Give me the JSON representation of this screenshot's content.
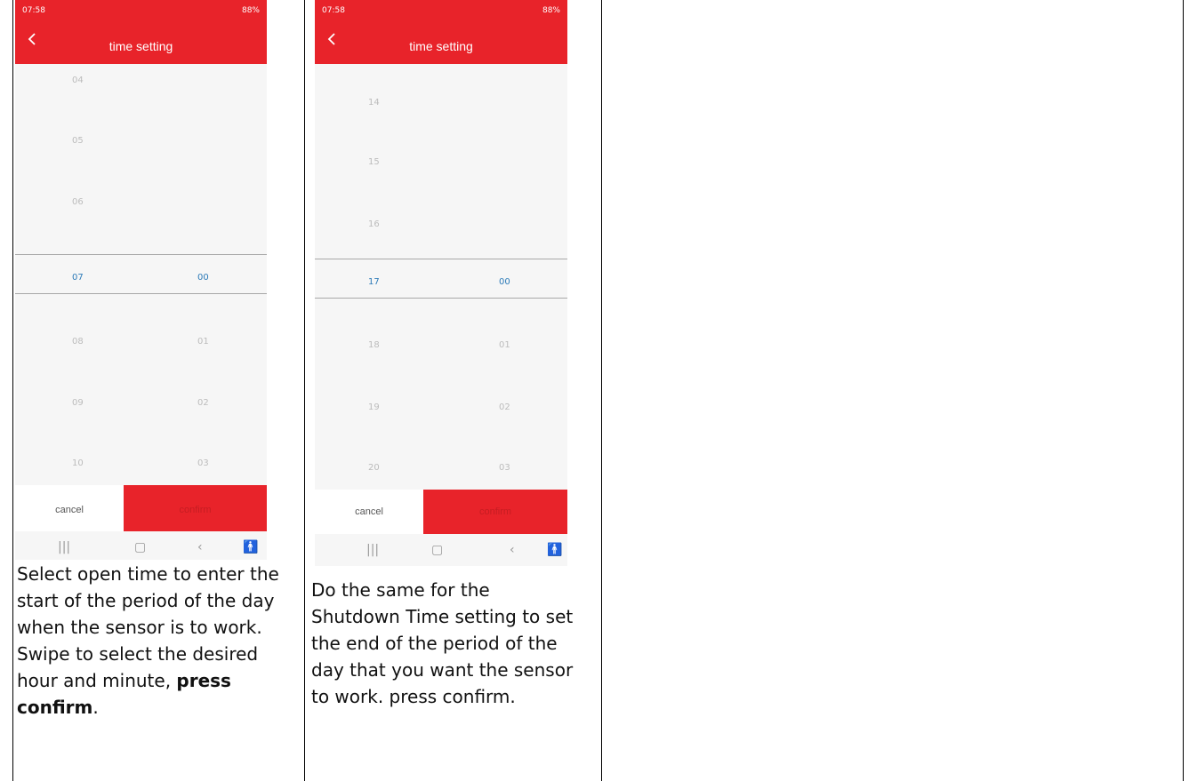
{
  "screens": [
    {
      "status_time": "07:58",
      "status_right": "88%",
      "title": "time setting",
      "hours": [
        "04",
        "05",
        "06",
        "07",
        "08",
        "09",
        "10"
      ],
      "minutes": [
        "",
        "",
        "",
        "00",
        "01",
        "02",
        "03"
      ],
      "cancel_label": "cancel",
      "confirm_label": "confirm",
      "caption_parts": [
        "Select open time to enter the start of the period of the day when the sensor is to work. Swipe to select the desired hour and minute, ",
        "press confirm",
        "."
      ]
    },
    {
      "status_time": "07:58",
      "status_right": "88%",
      "title": "time setting",
      "hours": [
        "14",
        "15",
        "16",
        "17",
        "18",
        "19",
        "20"
      ],
      "minutes": [
        "",
        "",
        "",
        "00",
        "01",
        "02",
        "03"
      ],
      "cancel_label": "cancel",
      "confirm_label": "confirm",
      "caption": "Do the same for the Shutdown Time setting to set the end of the period of the day that you want the sensor to work. press confirm."
    }
  ],
  "nav_icons": [
    "recents-icon",
    "home-icon",
    "back-icon",
    "accessibility-icon"
  ]
}
